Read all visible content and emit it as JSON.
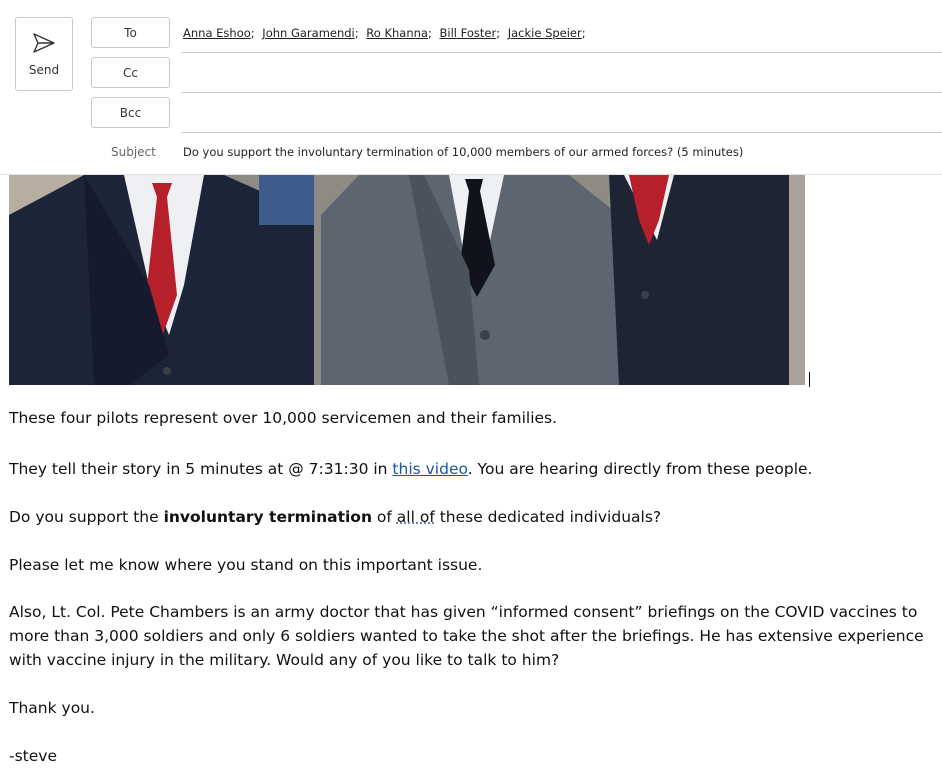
{
  "toolbar": {
    "send_label": "Send"
  },
  "fields": {
    "to_label": "To",
    "cc_label": "Cc",
    "bcc_label": "Bcc",
    "subject_label": "Subject",
    "subject_value": "Do you support the involuntary termination of 10,000 members of our armed forces? (5 minutes)",
    "recipients": [
      "Anna Eshoo",
      "John Garamendi",
      "Ro Khanna",
      "Bill Foster",
      "Jackie Speier"
    ],
    "separator": ";"
  },
  "body": {
    "p1": "These four pilots represent over 10,000 servicemen and their families.",
    "p2_pre": "They tell their story in 5 minutes at @ 7:31:30 in ",
    "p2_link": "this video",
    "p2_post": ". You are hearing directly from these people.",
    "p3_pre": "Do you support the ",
    "p3_bold": "involuntary termination",
    "p3_mid": " of ",
    "p3_dotted": "all of",
    "p3_post": " these dedicated individuals?",
    "p4": "Please let me know where you stand on this important issue.",
    "p5": "Also, Lt. Col. Pete Chambers is an army doctor that has given “informed consent” briefings on the COVID vaccines to more than 3,000 soldiers and only 6 soldiers wanted to take the shot after the briefings. He has extensive experience with vaccine injury in the military. Would any of you like to talk to him?",
    "p6": "Thank you.",
    "p7": "-steve"
  },
  "colors": {
    "link": "#1a55a3",
    "tie": "#b5202a",
    "suit_dark": "#1c2438",
    "suit_grey": "#5d6670"
  }
}
